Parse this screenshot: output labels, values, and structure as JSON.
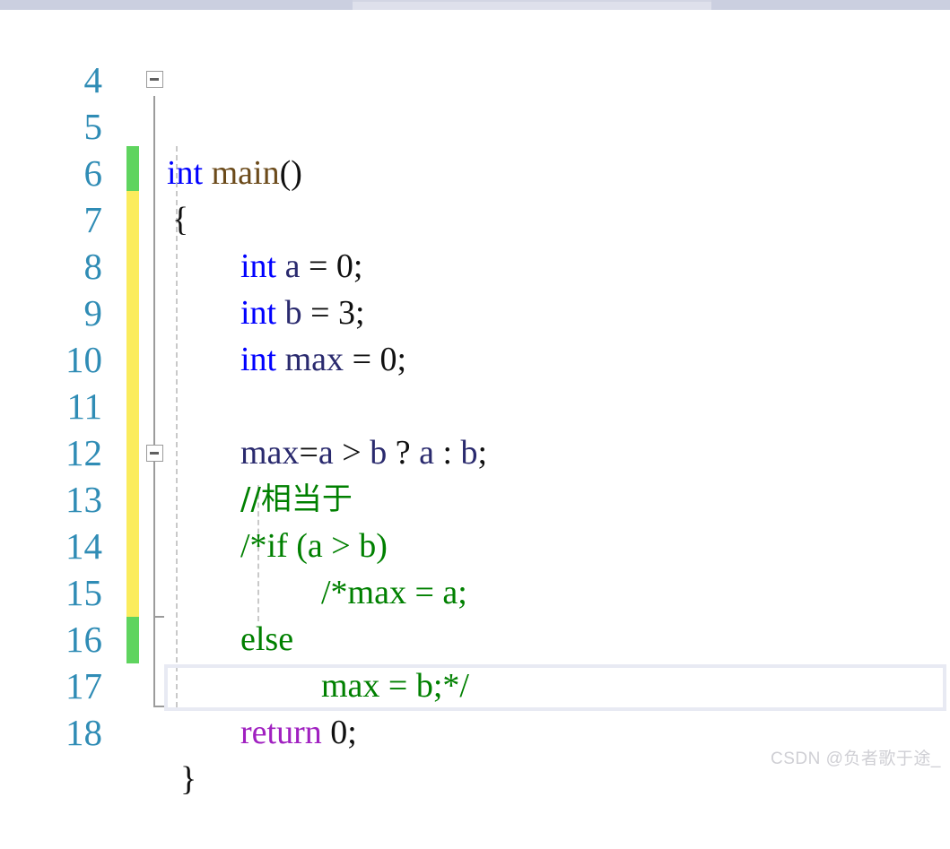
{
  "app": {
    "type": "code-editor",
    "language": "C"
  },
  "scrollbar": {
    "orientation": "horizontal",
    "track_color": "#d2d5e3",
    "thumb_color": "#cbcfe0"
  },
  "colors": {
    "line_number": "#2f8cb5",
    "keyword": "#0000ff",
    "keyword_return": "#a020c0",
    "identifier": "#2a2a6e",
    "comment": "#008000",
    "function_name": "#6b4a1a",
    "plain": "#101010",
    "change_saved": "#5fd45f",
    "change_unsaved": "#fbec5d",
    "current_line_border": "#e8eaf3",
    "fold_marker": "#9b9b9b",
    "indent_guide": "#c9c9c9",
    "watermark": "#cfcfd4"
  },
  "gutter": {
    "line_numbers": [
      "4",
      "5",
      "6",
      "7",
      "8",
      "9",
      "10",
      "11",
      "12",
      "13",
      "14",
      "15",
      "16",
      "17",
      "18"
    ]
  },
  "fold_markers": [
    {
      "line": "5",
      "state": "expanded",
      "glyph": "minus"
    },
    {
      "line": "13",
      "state": "expanded",
      "glyph": "minus"
    }
  ],
  "change_bars": [
    {
      "from_line": "7",
      "to_line": "7",
      "state": "saved"
    },
    {
      "from_line": "8",
      "to_line": "16",
      "state": "unsaved"
    },
    {
      "from_line": "17",
      "to_line": "17",
      "state": "saved"
    }
  ],
  "current_line": "18",
  "code": {
    "lines": [
      {
        "number": "4",
        "text": ""
      },
      {
        "number": "5",
        "text": "int main()"
      },
      {
        "number": "6",
        "text": "{"
      },
      {
        "number": "7",
        "text": "    int a = 0;"
      },
      {
        "number": "8",
        "text": "    int b = 3;"
      },
      {
        "number": "9",
        "text": "    int max = 0;"
      },
      {
        "number": "10",
        "text": ""
      },
      {
        "number": "11",
        "text": "    max=a > b ? a : b;"
      },
      {
        "number": "12",
        "text": "    //相当于"
      },
      {
        "number": "13",
        "text": "    /*if (a > b)"
      },
      {
        "number": "14",
        "text": "        /*max = a;"
      },
      {
        "number": "15",
        "text": "    else"
      },
      {
        "number": "16",
        "text": "        max = b;*/"
      },
      {
        "number": "17",
        "text": "    return 0;"
      },
      {
        "number": "18",
        "text": "}"
      }
    ],
    "tokens": {
      "l5_kw": "int",
      "l5_sp": " ",
      "l5_fn": "main",
      "l5_paren": "()",
      "l6_brace": "{",
      "l7_kw": "int",
      "l7_id": " a ",
      "l7_rest": "= 0;",
      "l8_kw": "int",
      "l8_id": " b ",
      "l8_rest": "= 3;",
      "l9_kw": "int",
      "l9_id": " max ",
      "l9_rest": "= 0;",
      "l11_id1": "max",
      "l11_eq": "=",
      "l11_id2": "a",
      "l11_op1": " > ",
      "l11_id3": "b",
      "l11_op2": " ? ",
      "l11_id4": "a",
      "l11_op3": " : ",
      "l11_id5": "b",
      "l11_end": ";",
      "l12_cmt": "//相当于",
      "l13_cmt": "/*if (a > b)",
      "l14_cmt": "/*max = a;",
      "l15_cmt": "else",
      "l16_cmt": "max = b;*/",
      "l17_kw": "return",
      "l17_rest": " 0;",
      "l18_brace": "}"
    }
  },
  "watermark": {
    "text": "CSDN @负者歌于途_"
  }
}
